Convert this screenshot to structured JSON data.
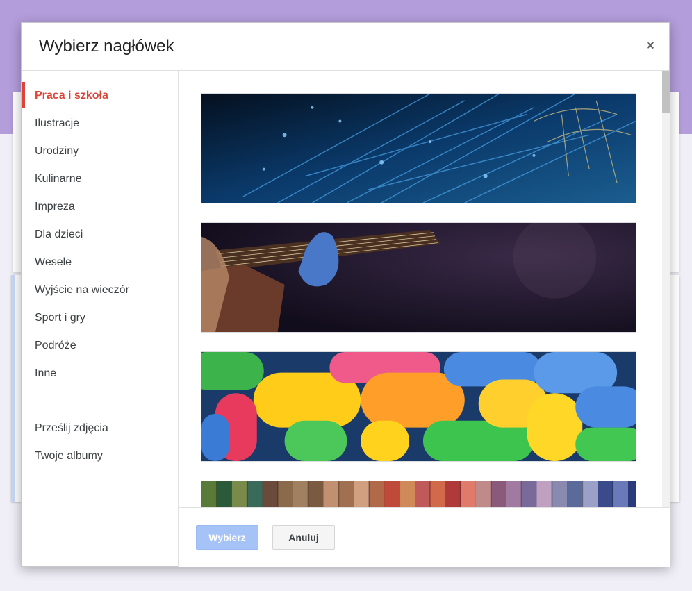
{
  "dialog": {
    "title": "Wybierz nagłówek",
    "close_label": "×"
  },
  "sidebar": {
    "categories": [
      {
        "label": "Praca i szkoła",
        "active": true
      },
      {
        "label": "Ilustracje"
      },
      {
        "label": "Urodziny"
      },
      {
        "label": "Kulinarne"
      },
      {
        "label": "Impreza"
      },
      {
        "label": "Dla dzieci"
      },
      {
        "label": "Wesele"
      },
      {
        "label": "Wyjście na wieczór"
      },
      {
        "label": "Sport i gry"
      },
      {
        "label": "Podróże"
      },
      {
        "label": "Inne"
      }
    ],
    "extra": [
      {
        "label": "Prześlij zdjęcia"
      },
      {
        "label": "Twoje albumy"
      }
    ]
  },
  "gallery": {
    "images": [
      {
        "name": "fiber-optics-spider-image"
      },
      {
        "name": "guitar-player-image"
      },
      {
        "name": "candy-image"
      },
      {
        "name": "yarn-image"
      }
    ]
  },
  "footer": {
    "select_label": "Wybierz",
    "cancel_label": "Anuluj"
  },
  "colors": {
    "accent": "#db4437",
    "primary_disabled": "#a6c3f7",
    "page_header": "#b39ddb"
  }
}
